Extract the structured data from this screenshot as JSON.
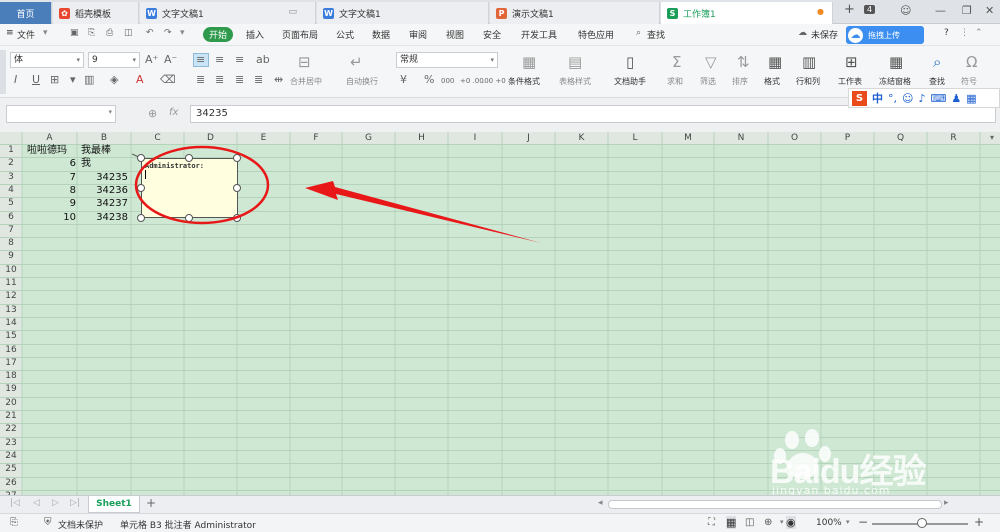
{
  "tabs": [
    {
      "label": "首页"
    },
    {
      "label": "稻壳模板",
      "icon": "docer-icon"
    },
    {
      "label": "文字文稿1",
      "icon": "word-doc-icon"
    },
    {
      "label": "文字文稿1",
      "icon": "word-doc-icon"
    },
    {
      "label": "演示文稿1",
      "icon": "ppt-doc-icon"
    },
    {
      "label": "工作簿1",
      "icon": "sheet-doc-icon"
    }
  ],
  "tab_counter": "4",
  "menu": {
    "file": "文件",
    "items": [
      "开始",
      "插入",
      "页面布局",
      "公式",
      "数据",
      "审阅",
      "视图",
      "安全",
      "开发工具",
      "特色应用"
    ],
    "search": "查找",
    "unsaved": "未保存",
    "upload_banner": "拖拽上传"
  },
  "toolbar": {
    "font_name": "体",
    "font_size": "9",
    "number_format": "常规",
    "merge_center": "合并居中",
    "auto_wrap": "自动换行",
    "cond_format": "条件格式",
    "table_style": "表格样式",
    "doc_helper": "文档助手",
    "sum": "求和",
    "filter": "筛选",
    "sort": "排序",
    "format": "格式",
    "row_col": "行和列",
    "worksheet": "工作表",
    "freeze": "冻结窗格",
    "find": "查找",
    "symbol": "符号",
    "percent": "%",
    "thousands": "000",
    "inc_dec": "+0 .00",
    "dec_dec": ".00 +0"
  },
  "formula_bar": {
    "cell_ref": "",
    "fx": "fx",
    "value": "34235"
  },
  "ime_toolbar": {
    "label": "中"
  },
  "columns": [
    "A",
    "B",
    "C",
    "D",
    "E",
    "F",
    "G",
    "H",
    "I",
    "J",
    "K",
    "L",
    "M",
    "N",
    "O",
    "P",
    "Q",
    "R"
  ],
  "rows": [
    "1",
    "2",
    "3",
    "4",
    "5",
    "6",
    "7",
    "8",
    "9",
    "10",
    "11",
    "12",
    "13",
    "14",
    "15",
    "16",
    "17",
    "18",
    "19",
    "20",
    "21",
    "22",
    "23",
    "24",
    "25",
    "26",
    "27",
    "28"
  ],
  "cells": {
    "A1": "啦啦德玛",
    "B1": "我最棒",
    "A2": "6",
    "B2": "我",
    "A3": "7",
    "B3": "34235",
    "A4": "8",
    "B4": "34236",
    "A5": "9",
    "B5": "34237",
    "A6": "10",
    "B6": "34238"
  },
  "comment": {
    "author": "Administrator:"
  },
  "sheet_tabs": [
    "Sheet1"
  ],
  "status": {
    "protect": "文档未保护",
    "cell_info": "单元格 B3 批注者 Administrator",
    "zoom": "100%"
  },
  "watermark": {
    "brand": "Baidu经验",
    "url": "jingyan.baidu.com"
  },
  "colors": {
    "accent": "#2f9a4c",
    "annotation": "#e81818",
    "grid_bg": "#cfe8d4",
    "comment_bg": "#ffffe0"
  }
}
